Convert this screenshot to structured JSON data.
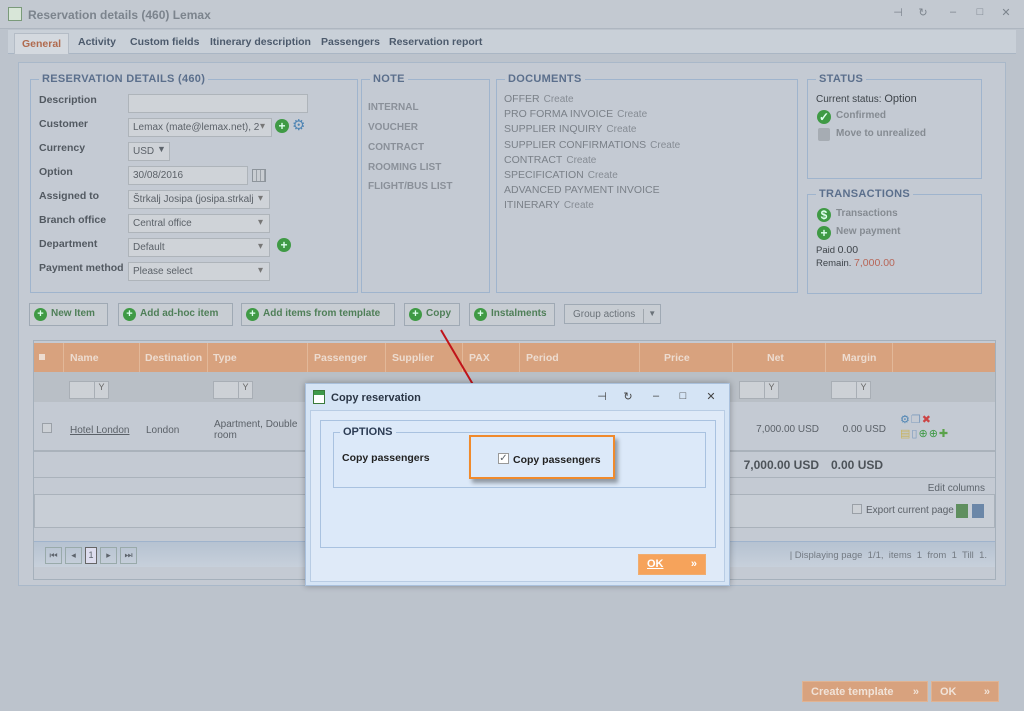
{
  "window": {
    "title": "Reservation details (460) Lemax",
    "controls": [
      "pin-icon",
      "refresh-icon",
      "minimize-icon",
      "maximize-icon",
      "close-icon"
    ]
  },
  "tabs": [
    "General",
    "Activity",
    "Custom fields",
    "Itinerary description",
    "Passengers",
    "Reservation report"
  ],
  "details": {
    "legend": "RESERVATION DETAILS (460)",
    "fields": [
      {
        "label": "Description",
        "value": ""
      },
      {
        "label": "Customer",
        "value": "Lemax (mate@lemax.net), 2"
      },
      {
        "label": "Currency",
        "value": "USD"
      },
      {
        "label": "Option",
        "value": "30/08/2016"
      },
      {
        "label": "Assigned to",
        "value": "Štrkalj Josipa (josipa.strkalj"
      },
      {
        "label": "Branch office",
        "value": "Central office"
      },
      {
        "label": "Department",
        "value": "Default"
      },
      {
        "label": "Payment method",
        "value": "Please select"
      }
    ]
  },
  "note": {
    "legend": "NOTE",
    "items": [
      "INTERNAL",
      "VOUCHER",
      "CONTRACT",
      "ROOMING LIST",
      "FLIGHT/BUS LIST"
    ]
  },
  "documents": {
    "legend": "DOCUMENTS",
    "create": "Create",
    "items": [
      {
        "name": "OFFER",
        "create": true
      },
      {
        "name": "PRO FORMA INVOICE",
        "create": true
      },
      {
        "name": "SUPPLIER INQUIRY",
        "create": true
      },
      {
        "name": "SUPPLIER CONFIRMATIONS",
        "create": true
      },
      {
        "name": "CONTRACT",
        "create": true
      },
      {
        "name": "SPECIFICATION",
        "create": true
      },
      {
        "name": "ADVANCED PAYMENT INVOICE",
        "create": false
      },
      {
        "name": "ITINERARY",
        "create": true
      }
    ]
  },
  "status": {
    "legend": "STATUS",
    "current_label": "Current status:",
    "current": "Option",
    "confirmed": "Confirmed",
    "unrealized": "Move to unrealized"
  },
  "transactions": {
    "legend": "TRANSACTIONS",
    "transactions": "Transactions",
    "new_payment": "New payment",
    "paid_label": "Paid",
    "paid": "0.00",
    "remain_label": "Remain.",
    "remain": "7,000.00"
  },
  "actions": {
    "new_item": "New Item",
    "adhoc": "Add ad-hoc item",
    "template": "Add items from template",
    "copy": "Copy",
    "instalments": "Instalments",
    "group": "Group actions"
  },
  "grid": {
    "columns": [
      "Name",
      "Destination",
      "Type",
      "Passenger",
      "Supplier",
      "PAX",
      "Period",
      "Price",
      "Net",
      "Margin"
    ],
    "row": {
      "name": "Hotel London",
      "destination": "London",
      "type": "Apartment, Double room",
      "net": "7,000.00 USD",
      "margin": "0.00 USD"
    },
    "totals": {
      "net": "7,000.00 USD",
      "margin": "0.00 USD"
    },
    "edit_columns": "Edit columns",
    "export": "Export current page",
    "page": "1",
    "paging": "| Displaying page  1/1,  items  1  from  1  Till  1."
  },
  "dialog": {
    "title": "Copy reservation",
    "legend": "OPTIONS",
    "label": "Copy passengers",
    "checkbox": "Copy passengers",
    "checked": true,
    "ok": "OK"
  },
  "footer": {
    "create_template": "Create template",
    "ok": "OK"
  },
  "colors": {
    "highlight": "#f08a2c",
    "arrow": "#c0141a",
    "header": "#d8a27e"
  }
}
